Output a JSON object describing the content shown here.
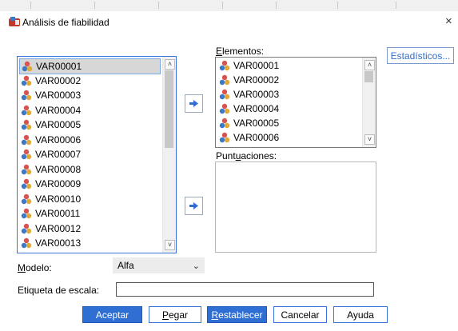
{
  "dialog": {
    "title": "Análisis de fiabilidad",
    "close": "×"
  },
  "source_list": {
    "items": [
      "VAR00001",
      "VAR00002",
      "VAR00003",
      "VAR00004",
      "VAR00005",
      "VAR00006",
      "VAR00007",
      "VAR00008",
      "VAR00009",
      "VAR00010",
      "VAR00011",
      "VAR00012",
      "VAR00013"
    ],
    "selected": "VAR00001"
  },
  "elementos": {
    "label_u": "E",
    "label_rest": "lementos:",
    "items": [
      "VAR00001",
      "VAR00002",
      "VAR00003",
      "VAR00004",
      "VAR00005",
      "VAR00006"
    ]
  },
  "puntuaciones": {
    "label_a": "Punt",
    "label_u": "u",
    "label_b": "aciones:"
  },
  "estadisticos_button": "Estadísticos...",
  "modelo": {
    "label_u": "M",
    "label_rest": "odelo:",
    "value": "Alfa",
    "arrow": "⌄"
  },
  "etiqueta": {
    "label": "Etiqueta de escala:",
    "value": ""
  },
  "buttons": {
    "aceptar": "Aceptar",
    "pegar_u": "P",
    "pegar_rest": "egar",
    "restablecer_u": "R",
    "restablecer_rest": "establecer",
    "cancelar": "Cancelar",
    "ayuda": "Ayuda"
  },
  "colors": {
    "accent": "#2f6fd4",
    "selection": "#d7d7d7"
  }
}
